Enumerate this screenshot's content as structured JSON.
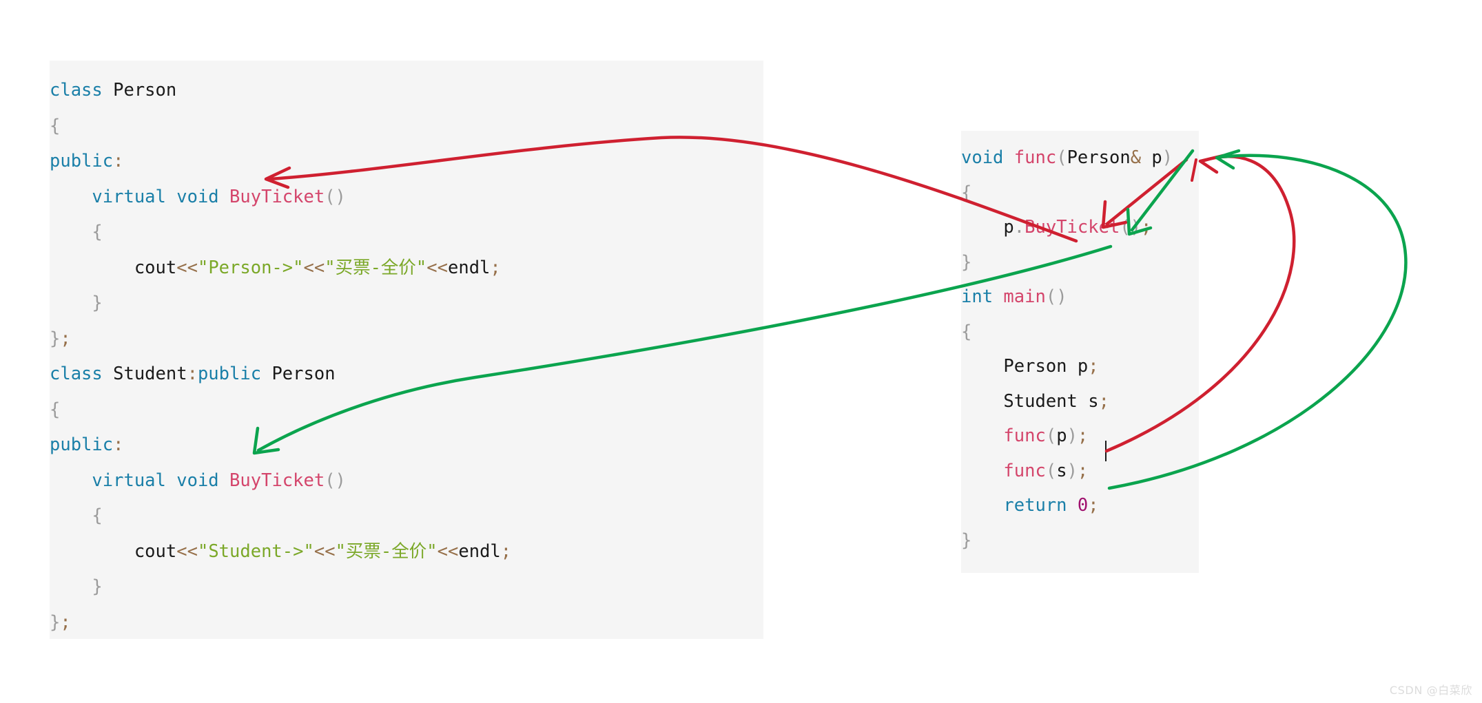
{
  "page": {
    "background": "#ffffff",
    "panel_background": "#f5f5f5"
  },
  "theme": {
    "keyword": "#1a7fa8",
    "function": "#d4456b",
    "identifier": "#1a1a1a",
    "string": "#7ba828",
    "operator": "#96704a",
    "number": "#a0116e",
    "punctuation": "#9b9b9b",
    "arrow_red": "#cf2030",
    "arrow_green": "#0ba44e"
  },
  "left_panel": {
    "name": "person-student-class-code",
    "lines": [
      {
        "indent": 0,
        "tokens": [
          {
            "t": "class",
            "c": "kw"
          },
          {
            "t": " ",
            "c": "pun"
          },
          {
            "t": "Person",
            "c": "id"
          }
        ]
      },
      {
        "indent": 0,
        "tokens": [
          {
            "t": "{",
            "c": "pun"
          }
        ]
      },
      {
        "indent": 0,
        "tokens": [
          {
            "t": "public",
            "c": "kw"
          },
          {
            "t": ":",
            "c": "op"
          }
        ]
      },
      {
        "indent": 1,
        "tokens": [
          {
            "t": "virtual",
            "c": "kw"
          },
          {
            "t": " ",
            "c": "id"
          },
          {
            "t": "void",
            "c": "kw"
          },
          {
            "t": " ",
            "c": "id"
          },
          {
            "t": "BuyTicket",
            "c": "fn"
          },
          {
            "t": "()",
            "c": "pun"
          }
        ]
      },
      {
        "indent": 1,
        "tokens": [
          {
            "t": "{",
            "c": "pun"
          }
        ]
      },
      {
        "indent": 2,
        "tokens": [
          {
            "t": "cout",
            "c": "id"
          },
          {
            "t": "<<",
            "c": "op"
          },
          {
            "t": "\"Person->\"",
            "c": "str"
          },
          {
            "t": "<<",
            "c": "op"
          },
          {
            "t": "\"买票-全价\"",
            "c": "str"
          },
          {
            "t": "<<",
            "c": "op"
          },
          {
            "t": "endl",
            "c": "id"
          },
          {
            "t": ";",
            "c": "op"
          }
        ]
      },
      {
        "indent": 1,
        "tokens": [
          {
            "t": "}",
            "c": "pun"
          }
        ]
      },
      {
        "indent": 0,
        "tokens": [
          {
            "t": "}",
            "c": "pun"
          },
          {
            "t": ";",
            "c": "op"
          }
        ]
      },
      {
        "indent": 0,
        "tokens": [
          {
            "t": "class",
            "c": "kw"
          },
          {
            "t": " ",
            "c": "pun"
          },
          {
            "t": "Student",
            "c": "id"
          },
          {
            "t": ":",
            "c": "op"
          },
          {
            "t": "public",
            "c": "kw"
          },
          {
            "t": " ",
            "c": "id"
          },
          {
            "t": "Person",
            "c": "id"
          }
        ]
      },
      {
        "indent": 0,
        "tokens": [
          {
            "t": "{",
            "c": "pun"
          }
        ]
      },
      {
        "indent": 0,
        "tokens": [
          {
            "t": "public",
            "c": "kw"
          },
          {
            "t": ":",
            "c": "op"
          }
        ]
      },
      {
        "indent": 1,
        "tokens": [
          {
            "t": "virtual",
            "c": "kw"
          },
          {
            "t": " ",
            "c": "id"
          },
          {
            "t": "void",
            "c": "kw"
          },
          {
            "t": " ",
            "c": "id"
          },
          {
            "t": "BuyTicket",
            "c": "fn"
          },
          {
            "t": "()",
            "c": "pun"
          }
        ]
      },
      {
        "indent": 1,
        "tokens": [
          {
            "t": "{",
            "c": "pun"
          }
        ]
      },
      {
        "indent": 2,
        "tokens": [
          {
            "t": "cout",
            "c": "id"
          },
          {
            "t": "<<",
            "c": "op"
          },
          {
            "t": "\"Student->\"",
            "c": "str"
          },
          {
            "t": "<<",
            "c": "op"
          },
          {
            "t": "\"买票-全价\"",
            "c": "str"
          },
          {
            "t": "<<",
            "c": "op"
          },
          {
            "t": "endl",
            "c": "id"
          },
          {
            "t": ";",
            "c": "op"
          }
        ]
      },
      {
        "indent": 1,
        "tokens": [
          {
            "t": "}",
            "c": "pun"
          }
        ]
      },
      {
        "indent": 0,
        "tokens": [
          {
            "t": "}",
            "c": "pun"
          },
          {
            "t": ";",
            "c": "op"
          }
        ]
      }
    ]
  },
  "right_panel": {
    "name": "func-main-code",
    "lines": [
      {
        "indent": 0,
        "tokens": [
          {
            "t": "void",
            "c": "kw"
          },
          {
            "t": " ",
            "c": "id"
          },
          {
            "t": "func",
            "c": "fn"
          },
          {
            "t": "(",
            "c": "pun"
          },
          {
            "t": "Person",
            "c": "id"
          },
          {
            "t": "&",
            "c": "op"
          },
          {
            "t": " p",
            "c": "id"
          },
          {
            "t": ")",
            "c": "pun"
          }
        ]
      },
      {
        "indent": 0,
        "tokens": [
          {
            "t": "{",
            "c": "pun"
          }
        ]
      },
      {
        "indent": 1,
        "tokens": [
          {
            "t": "p",
            "c": "id"
          },
          {
            "t": ".",
            "c": "pun"
          },
          {
            "t": "BuyTicket",
            "c": "fn"
          },
          {
            "t": "()",
            "c": "pun"
          },
          {
            "t": ";",
            "c": "op"
          }
        ]
      },
      {
        "indent": 0,
        "tokens": [
          {
            "t": "}",
            "c": "pun"
          }
        ]
      },
      {
        "indent": 0,
        "tokens": [
          {
            "t": "int",
            "c": "kw"
          },
          {
            "t": " ",
            "c": "id"
          },
          {
            "t": "main",
            "c": "fn"
          },
          {
            "t": "()",
            "c": "pun"
          }
        ]
      },
      {
        "indent": 0,
        "tokens": [
          {
            "t": "{",
            "c": "pun"
          }
        ]
      },
      {
        "indent": 1,
        "tokens": [
          {
            "t": "Person p",
            "c": "id"
          },
          {
            "t": ";",
            "c": "op"
          }
        ]
      },
      {
        "indent": 1,
        "tokens": [
          {
            "t": "Student s",
            "c": "id"
          },
          {
            "t": ";",
            "c": "op"
          }
        ]
      },
      {
        "indent": 1,
        "tokens": [
          {
            "t": "func",
            "c": "fn"
          },
          {
            "t": "(",
            "c": "pun"
          },
          {
            "t": "p",
            "c": "id"
          },
          {
            "t": ")",
            "c": "pun"
          },
          {
            "t": ";",
            "c": "op"
          }
        ]
      },
      {
        "indent": 1,
        "tokens": [
          {
            "t": "func",
            "c": "fn"
          },
          {
            "t": "(",
            "c": "pun"
          },
          {
            "t": "s",
            "c": "id"
          },
          {
            "t": ")",
            "c": "pun"
          },
          {
            "t": ";",
            "c": "op"
          }
        ]
      },
      {
        "indent": 1,
        "tokens": [
          {
            "t": "return",
            "c": "kw"
          },
          {
            "t": " ",
            "c": "id"
          },
          {
            "t": "0",
            "c": "num"
          },
          {
            "t": ";",
            "c": "op"
          }
        ]
      },
      {
        "indent": 0,
        "tokens": [
          {
            "t": "}",
            "c": "pun"
          }
        ]
      }
    ]
  },
  "annotations": {
    "red_arrows": [
      {
        "name": "red-arrow-funcp-to-param-p",
        "desc": "func(p) call binds to parameter p"
      },
      {
        "name": "red-arrow-param-p-to-buyticket-call",
        "desc": "p resolves to p.BuyTicket()"
      },
      {
        "name": "red-arrow-buyticket-to-person-buyticket",
        "desc": "dispatches to Person::BuyTicket"
      }
    ],
    "green_arrows": [
      {
        "name": "green-arrow-funcs-to-param-p",
        "desc": "func(s) call binds to parameter p"
      },
      {
        "name": "green-arrow-param-p-to-buyticket-call",
        "desc": "p resolves to p.BuyTicket()"
      },
      {
        "name": "green-arrow-buyticket-to-student-buyticket",
        "desc": "dispatches to Student::BuyTicket"
      }
    ]
  },
  "caret": {
    "name": "text-caret",
    "visible": true
  },
  "watermark": {
    "text": "CSDN @白菜欣"
  }
}
